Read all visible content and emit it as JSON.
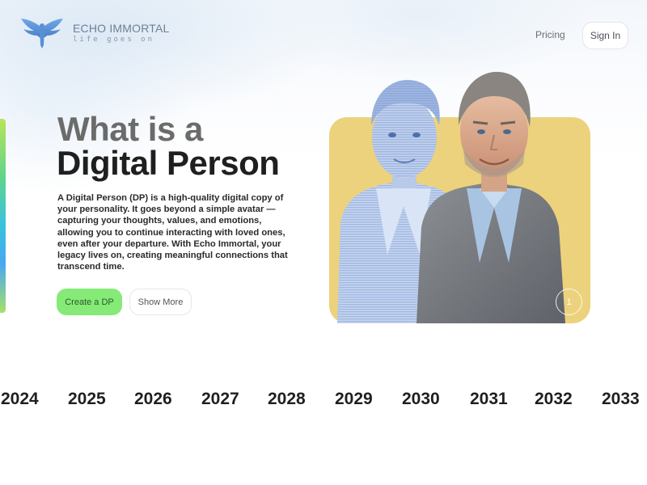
{
  "header": {
    "brand_name": "ECHO IMMORTAL",
    "brand_tagline": "life goes on",
    "logo_icon": "winged-emblem-icon",
    "nav": {
      "pricing": "Pricing",
      "sign_in": "Sign In"
    }
  },
  "hero": {
    "title_line1": "What is a",
    "title_line2": "Digital Person",
    "description": "A Digital Person (DP) is a high-quality digital copy of your personality. It goes beyond a simple avatar — capturing your thoughts, values, and emotions, allowing you to continue interacting with loved ones, even after your departure. With Echo Immortal, your legacy lives on, creating meaningful connections that transcend time.",
    "buttons": {
      "create": "Create a DP",
      "show_more": "Show More"
    },
    "slide_indicator": "1",
    "colors": {
      "accent_green": "#85ea77",
      "panel_yellow": "#ecd27c",
      "text_dark": "#1f1f1f",
      "text_gray": "#6b6b6b"
    }
  },
  "timeline": {
    "years": [
      "2024",
      "2025",
      "2026",
      "2027",
      "2028",
      "2029",
      "2030",
      "2031",
      "2032",
      "2033"
    ]
  }
}
